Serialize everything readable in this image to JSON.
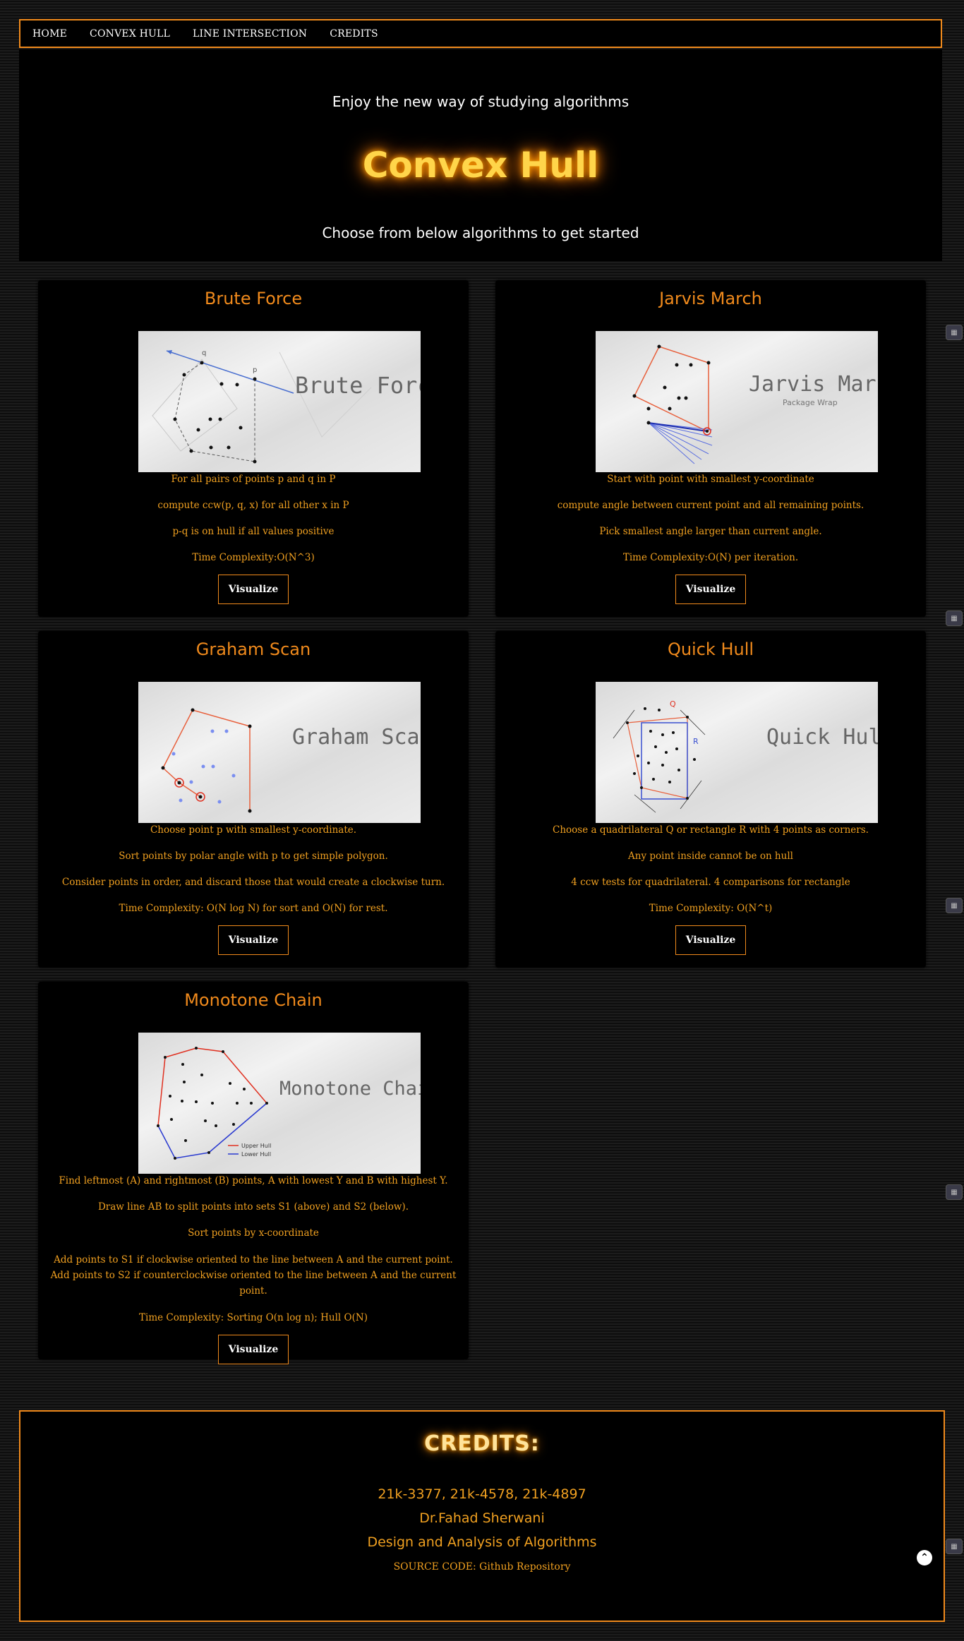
{
  "nav": {
    "items": [
      "HOME",
      "CONVEX HULL",
      "LINE INTERSECTION",
      "CREDITS"
    ]
  },
  "hero": {
    "tagline": "Enjoy the new way of studying algorithms",
    "title": "Convex Hull",
    "subtitle": "Choose from below algorithms to get started"
  },
  "cards": [
    {
      "title": "Brute Force",
      "image_label": "Brute Force",
      "lines": [
        "For all pairs of points p and q in P",
        "compute ccw(p, q, x) for all other x in P",
        "p-q is on hull if all values positive",
        "Time Complexity:O(N^3)"
      ],
      "button": "Visualize"
    },
    {
      "title": "Jarvis March",
      "image_label": "Jarvis March",
      "image_sublabel": "Package Wrap",
      "lines": [
        "Start with point with smallest y-coordinate",
        "compute angle between current point and all remaining points.",
        "Pick smallest angle larger than current angle.",
        "Time Complexity:O(N) per iteration."
      ],
      "button": "Visualize"
    },
    {
      "title": "Graham Scan",
      "image_label": "Graham Scan",
      "lines": [
        "Choose point p with smallest y-coordinate.",
        "Sort points by polar angle with p to get simple polygon.",
        "Consider points in order, and discard those that would create a clockwise turn.",
        "Time Complexity: O(N log N) for sort and O(N) for rest."
      ],
      "button": "Visualize"
    },
    {
      "title": "Quick Hull",
      "image_label": "Quick Hull",
      "lines": [
        "Choose a quadrilateral Q or rectangle R with 4 points as corners.",
        "Any point inside cannot be on hull",
        "4 ccw tests for quadrilateral. 4 comparisons for rectangle",
        "Time Complexity: O(N^t)"
      ],
      "button": "Visualize"
    },
    {
      "title": "Monotone Chain",
      "image_label": "Monotone Chain",
      "legend_upper": "Upper Hull",
      "legend_lower": "Lower Hull",
      "lines": [
        "Find leftmost (A) and rightmost (B) points, A with lowest Y and B with highest Y.",
        "Draw line AB to split points into sets S1 (above) and S2 (below).",
        "Sort points by x-coordinate",
        "Add points to S1 if clockwise oriented to the line between A and the current point. Add points to S2 if counterclockwise oriented to the line between A and the current point.",
        "Time Complexity: Sorting O(n log n); Hull O(N)"
      ],
      "button": "Visualize"
    }
  ],
  "credits": {
    "title": "CREDITS:",
    "ids": "21k-3377, 21k-4578, 21k-4897",
    "instructor": "Dr.Fahad Sherwani",
    "course": "Design and Analysis of Algorithms",
    "source": "SOURCE CODE: Github Repository"
  }
}
